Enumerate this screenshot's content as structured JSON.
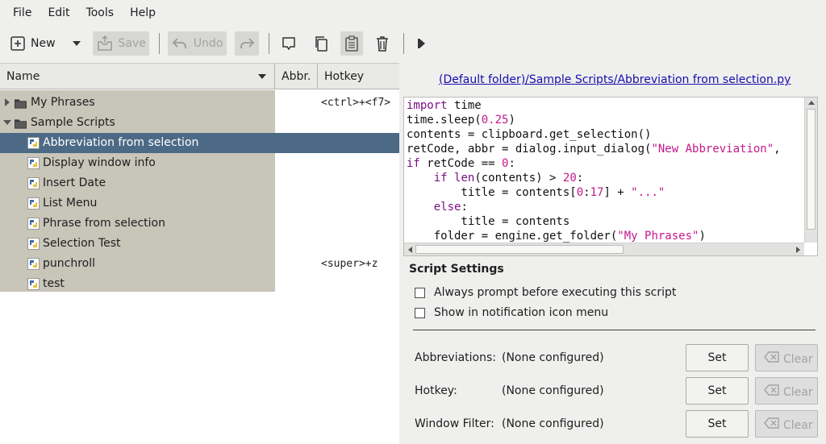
{
  "menubar": {
    "items": [
      "File",
      "Edit",
      "Tools",
      "Help"
    ]
  },
  "toolbar": {
    "new_label": "New",
    "save_label": "Save",
    "undo_label": "Undo"
  },
  "tree": {
    "columns": {
      "name": "Name",
      "abbr": "Abbr.",
      "hotkey": "Hotkey"
    },
    "rows": [
      {
        "label": "My Phrases",
        "hotkey": "<ctrl>+<f7>"
      },
      {
        "label": "Sample Scripts",
        "hotkey": ""
      },
      {
        "label": "Abbreviation from selection",
        "hotkey": ""
      },
      {
        "label": "Display window info",
        "hotkey": ""
      },
      {
        "label": "Insert Date",
        "hotkey": ""
      },
      {
        "label": "List Menu",
        "hotkey": ""
      },
      {
        "label": "Phrase from selection",
        "hotkey": ""
      },
      {
        "label": "Selection Test",
        "hotkey": ""
      },
      {
        "label": "punchroll",
        "hotkey": "<super>+z"
      },
      {
        "label": "test",
        "hotkey": ""
      }
    ]
  },
  "editor": {
    "path": "(Default folder)/Sample Scripts/Abbreviation from selection.py",
    "lines": [
      "import time",
      "time.sleep(0.25)",
      "contents = clipboard.get_selection()",
      "retCode, abbr = dialog.input_dialog(\"New Abbreviation\",",
      "if retCode == 0:",
      "    if len(contents) > 20:",
      "        title = contents[0:17] + \"...\"",
      "    else:",
      "        title = contents",
      "    folder = engine.get_folder(\"My Phrases\")"
    ]
  },
  "settings": {
    "title": "Script Settings",
    "always_prompt": "Always prompt before executing this script",
    "show_in_notification": "Show in notification icon menu",
    "rows": [
      {
        "label": "Abbreviations:",
        "value": "(None configured)",
        "set": "Set",
        "clear": "Clear"
      },
      {
        "label": "Hotkey:",
        "value": "(None configured)",
        "set": "Set",
        "clear": "Clear"
      },
      {
        "label": "Window Filter:",
        "value": "(None configured)",
        "set": "Set",
        "clear": "Clear"
      }
    ]
  },
  "colors": {
    "selection": "#4c6a86",
    "tree_bg": "#c8c5b9",
    "link": "#1a0dab",
    "keyword": "#7b0f85",
    "literal": "#c4188c"
  }
}
